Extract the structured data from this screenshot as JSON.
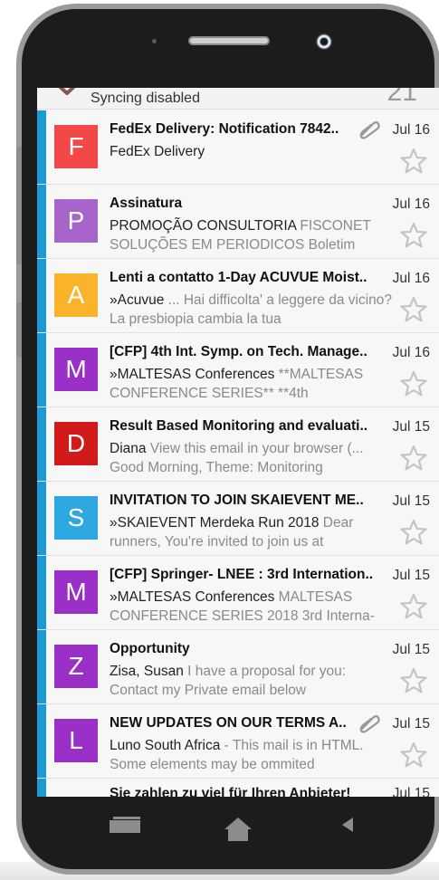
{
  "status": {
    "sync_text": "Syncing disabled",
    "unread_count": "21"
  },
  "colors": {
    "unread_stripe": "#1b9bd6",
    "star": "#d0d0d0"
  },
  "emails": [
    {
      "letter": "F",
      "color": "#f24848",
      "subject": "FedEx Delivery: Notification 7842..",
      "attachment": true,
      "date": "Jul 16",
      "sender": "FedEx Delivery",
      "preview": ""
    },
    {
      "letter": "P",
      "color": "#a565c9",
      "subject": "Assinatura",
      "attachment": false,
      "date": "Jul 16",
      "sender": "PROMOÇÃO CONSULTORIA",
      "preview": " FISCONET SOLUÇÕES EM PERIODICOS Boletim"
    },
    {
      "letter": "A",
      "color": "#fbb42a",
      "subject": "Lenti a contatto 1-Day ACUVUE Moist..",
      "attachment": false,
      "date": "Jul 16",
      "sender": "»Acuvue",
      "preview": " ... Hai difficolta' a leggere da vicino? La presbiopia cambia la tua"
    },
    {
      "letter": "M",
      "color": "#9a2fc7",
      "subject": "[CFP] 4th Int. Symp. on Tech. Manage..",
      "attachment": false,
      "date": "Jul 16",
      "sender": "»MALTESAS Conferences",
      "preview": " **MALTESAS CONFERENCE SERIES** **4th"
    },
    {
      "letter": "D",
      "color": "#d11b1b",
      "subject": "Result Based Monitoring and evaluati..",
      "attachment": false,
      "date": "Jul 15",
      "sender": "Diana",
      "preview": " View this email in your browser (... Good Morning, Theme: Monitoring"
    },
    {
      "letter": "S",
      "color": "#2ea8e0",
      "subject": "INVITATION TO JOIN SKAIEVENT ME..",
      "attachment": false,
      "date": "Jul 15",
      "sender": "»SKAIEVENT Merdeka Run 2018",
      "preview": " Dear runners, You're invited to join us at"
    },
    {
      "letter": "M",
      "color": "#9a2fc7",
      "subject": "[CFP] Springer- LNEE : 3rd Internation..",
      "attachment": false,
      "date": "Jul 15",
      "sender": "»MALTESAS Conferences",
      "preview": " MALTESAS CONFERENCE SERIES 2018 3rd Interna-"
    },
    {
      "letter": "Z",
      "color": "#9a2fc7",
      "subject": "Opportunity",
      "attachment": false,
      "date": "Jul 15",
      "sender": "Zisa, Susan",
      "preview": " I have a proposal for you: Contact my Private email below"
    },
    {
      "letter": "L",
      "color": "#9a2fc7",
      "subject": "NEW UPDATES ON OUR TERMS A..",
      "attachment": true,
      "date": "Jul 15",
      "sender": "Luno South Africa",
      "preview": " - This mail is in HTML. Some elements may be ommited"
    }
  ],
  "partial_email": {
    "subject": "Sie zahlen zu viel für Ihren Anbieter!",
    "date": "Jul 15"
  }
}
